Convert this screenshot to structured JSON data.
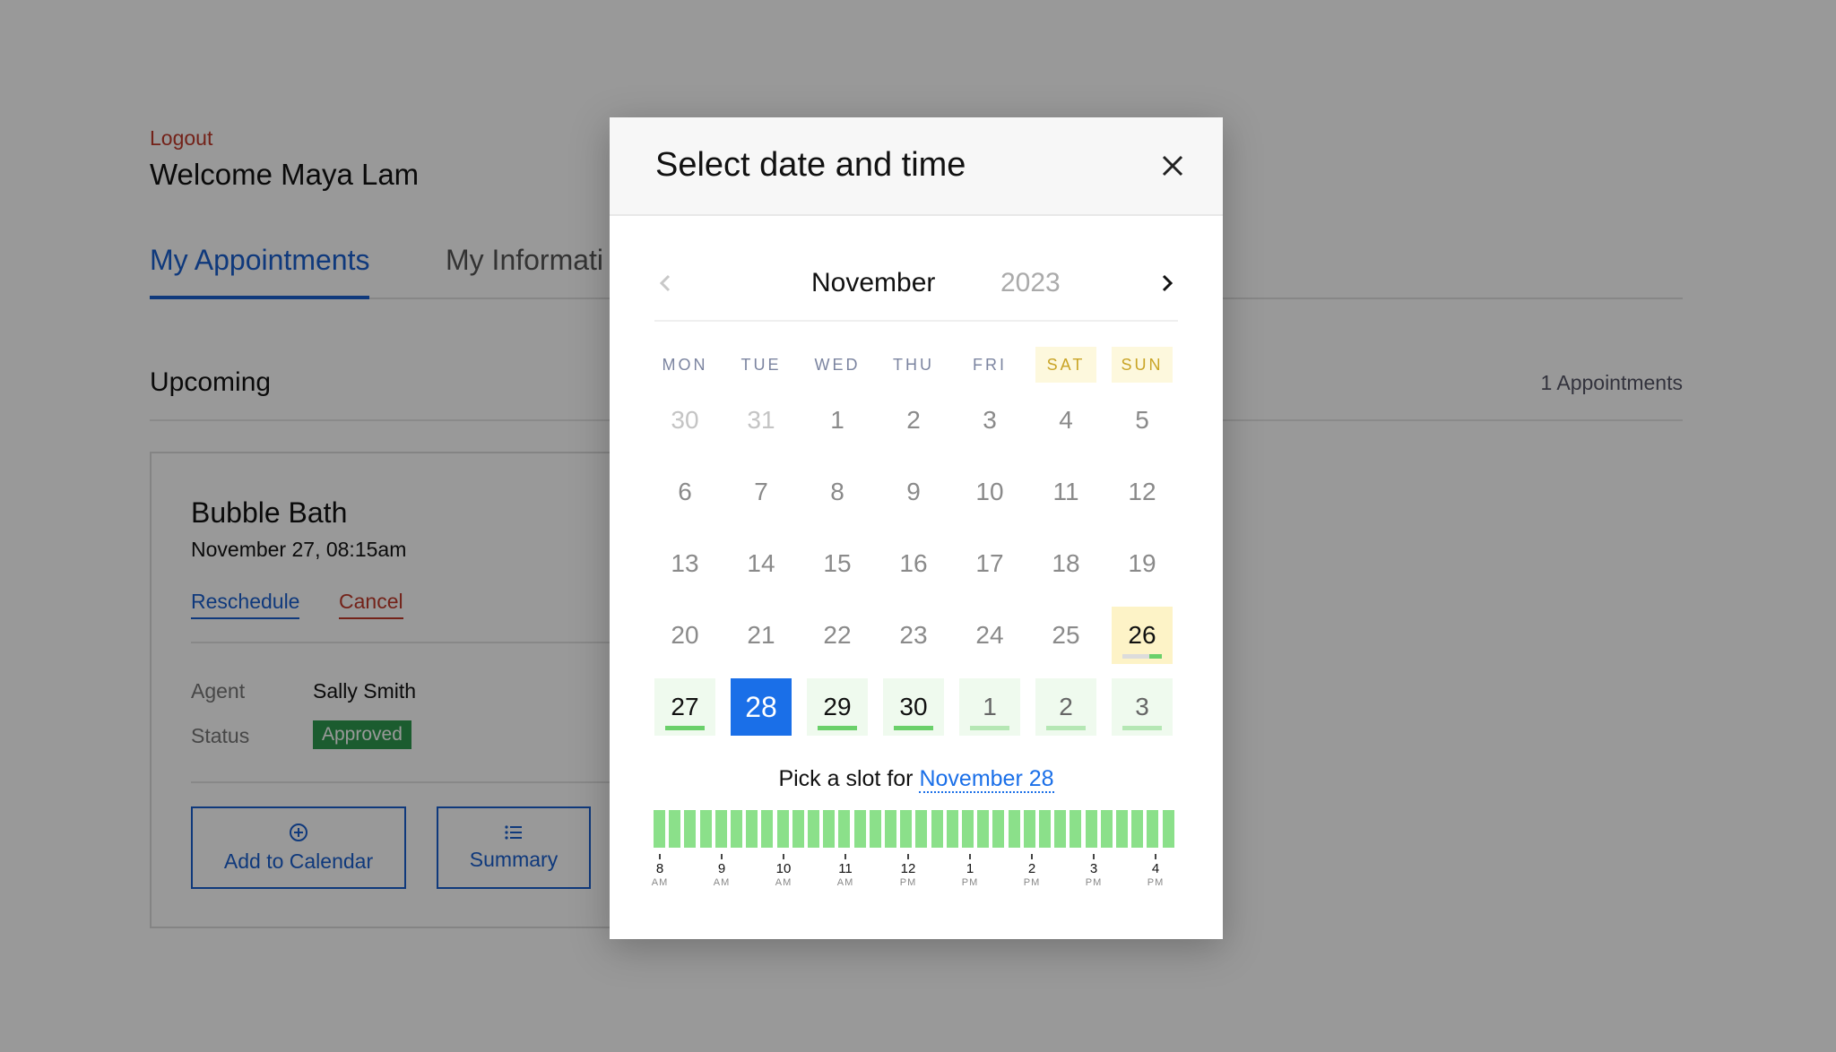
{
  "header": {
    "logout": "Logout",
    "welcome": "Welcome Maya Lam"
  },
  "tabs": [
    {
      "label": "My Appointments",
      "active": true
    },
    {
      "label": "My Informati"
    }
  ],
  "upcoming": {
    "title": "Upcoming",
    "count": "1 Appointments"
  },
  "appointment": {
    "title": "Bubble Bath",
    "when": "November 27, 08:15am",
    "reschedule": "Reschedule",
    "cancel": "Cancel",
    "agent_label": "Agent",
    "agent": "Sally Smith",
    "status_label": "Status",
    "status": "Approved",
    "add_to_calendar": "Add to Calendar",
    "summary": "Summary"
  },
  "modal": {
    "title": "Select date and time",
    "month": "November",
    "year": "2023",
    "weekdays": [
      "MON",
      "TUE",
      "WED",
      "THU",
      "FRI",
      "SAT",
      "SUN"
    ],
    "weeks": [
      [
        "30",
        "31",
        "1",
        "2",
        "3",
        "4",
        "5"
      ],
      [
        "6",
        "7",
        "8",
        "9",
        "10",
        "11",
        "12"
      ],
      [
        "13",
        "14",
        "15",
        "16",
        "17",
        "18",
        "19"
      ],
      [
        "20",
        "21",
        "22",
        "23",
        "24",
        "25",
        "26"
      ],
      [
        "27",
        "28",
        "29",
        "30",
        "1",
        "2",
        "3"
      ]
    ],
    "pick_prefix": "Pick a slot for ",
    "pick_date": "November 28",
    "ticks": [
      {
        "hour": "8",
        "ampm": "AM"
      },
      {
        "hour": "9",
        "ampm": "AM"
      },
      {
        "hour": "10",
        "ampm": "AM"
      },
      {
        "hour": "11",
        "ampm": "AM"
      },
      {
        "hour": "12",
        "ampm": "PM"
      },
      {
        "hour": "1",
        "ampm": "PM"
      },
      {
        "hour": "2",
        "ampm": "PM"
      },
      {
        "hour": "3",
        "ampm": "PM"
      },
      {
        "hour": "4",
        "ampm": "PM"
      }
    ]
  },
  "colors": {
    "accent": "#1a6fe8",
    "link": "#1a5fcf",
    "danger": "#c0392b",
    "approved": "#2e9a4f",
    "slot": "#8be08a",
    "weekend": "#c9a426"
  },
  "icons": {
    "close": "close-icon",
    "prev": "chevron-left-icon",
    "next": "chevron-right-icon",
    "add": "plus-circle-icon",
    "summary": "list-icon"
  }
}
